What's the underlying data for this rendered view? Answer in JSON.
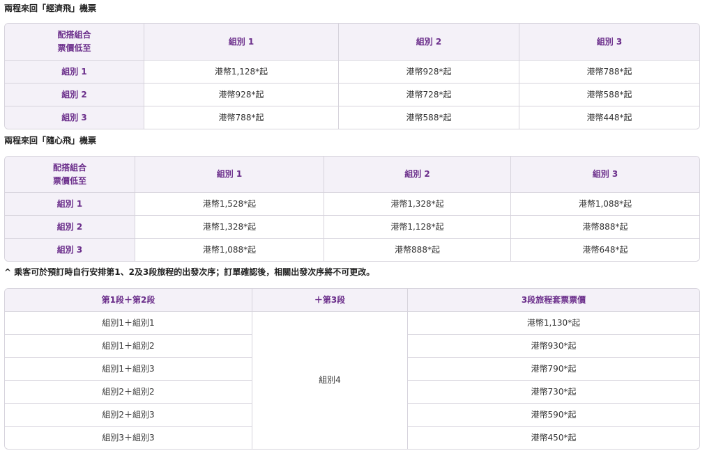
{
  "economy": {
    "title": "兩程來回「經濟飛」機票",
    "corner_label_line1": "配搭組合",
    "corner_label_line2": "票價低至",
    "columns": [
      "組別 1",
      "組別 2",
      "組別 3"
    ],
    "rows": [
      {
        "label": "組別 1",
        "values": [
          "港幣1,128*起",
          "港幣928*起",
          "港幣788*起"
        ]
      },
      {
        "label": "組別 2",
        "values": [
          "港幣928*起",
          "港幣728*起",
          "港幣588*起"
        ]
      },
      {
        "label": "組別 3",
        "values": [
          "港幣788*起",
          "港幣588*起",
          "港幣448*起"
        ]
      }
    ]
  },
  "flex": {
    "title": "兩程來回「隨心飛」機票",
    "corner_label_line1": "配搭組合",
    "corner_label_line2": "票價低至",
    "columns": [
      "組別 1",
      "組別 2",
      "組別 3"
    ],
    "rows": [
      {
        "label": "組別 1",
        "values": [
          "港幣1,528*起",
          "港幣1,328*起",
          "港幣1,088*起"
        ]
      },
      {
        "label": "組別 2",
        "values": [
          "港幣1,328*起",
          "港幣1,128*起",
          "港幣888*起"
        ]
      },
      {
        "label": "組別 3",
        "values": [
          "港幣1,088*起",
          "港幣888*起",
          "港幣648*起"
        ]
      }
    ]
  },
  "note": "^ 乘客可於預訂時自行安排第1、2及3段旅程的出發次序；訂單確認後，相關出發次序將不可更改。",
  "three_segment": {
    "headers": [
      "第1段＋第2段",
      "＋第3段",
      "3段旅程套票票價"
    ],
    "third_segment": "組別4",
    "rows": [
      {
        "combo": "組別1＋組別1",
        "price": "港幣1,130*起"
      },
      {
        "combo": "組別1＋組別2",
        "price": "港幣930*起"
      },
      {
        "combo": "組別1＋組別3",
        "price": "港幣790*起"
      },
      {
        "combo": "組別2＋組別2",
        "price": "港幣730*起"
      },
      {
        "combo": "組別2＋組別3",
        "price": "港幣590*起"
      },
      {
        "combo": "組別3＋組別3",
        "price": "港幣450*起"
      }
    ]
  }
}
